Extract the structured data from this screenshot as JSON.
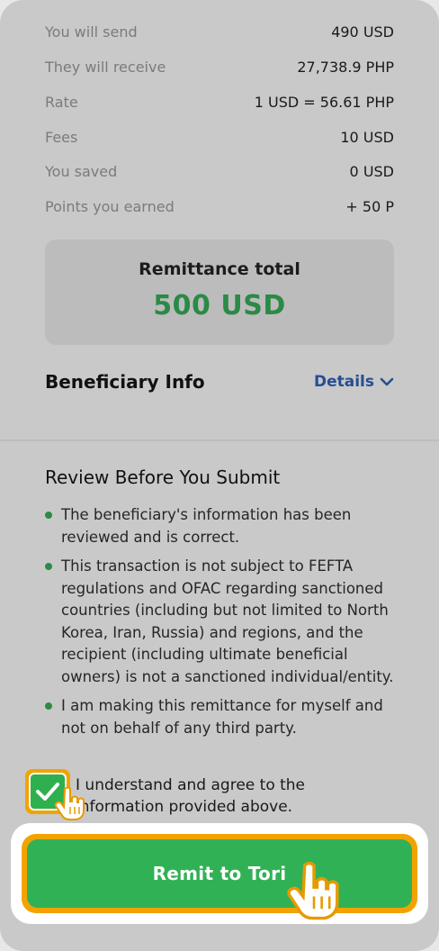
{
  "summary": {
    "rows": [
      {
        "label": "You will send",
        "value": "490 USD"
      },
      {
        "label": "They will receive",
        "value": "27,738.9 PHP"
      },
      {
        "label": "Rate",
        "value": "1 USD = 56.61 PHP"
      },
      {
        "label": "Fees",
        "value": "10 USD"
      },
      {
        "label": "You saved",
        "value": "0 USD"
      },
      {
        "label": "Points you earned",
        "value": "+ 50 P"
      }
    ]
  },
  "total": {
    "label": "Remittance total",
    "amount": "500 USD"
  },
  "beneficiary": {
    "title": "Beneficiary Info",
    "details_label": "Details"
  },
  "review": {
    "title": "Review Before You Submit",
    "bullets": [
      "The beneficiary's information has been reviewed and is correct.",
      "This transaction is not subject to FEFTA regulations and OFAC regarding sanctioned countries (including but not limited to North Korea, Iran, Russia) and regions, and the recipient (including ultimate beneficial owners) is not a sanctioned individual/entity.",
      "I am making this remittance for myself and not on behalf of any third party."
    ],
    "agree_text": "I understand and agree to the information provided above.",
    "agree_checked": true
  },
  "submit": {
    "label": "Remit to Tori"
  },
  "colors": {
    "accent_green": "#31b155",
    "total_green": "#2a8a46",
    "link_blue": "#264e92",
    "highlight_orange": "#f2a300"
  },
  "icons": [
    "chevron-down-icon",
    "check-icon",
    "pointer-hand-icon"
  ]
}
